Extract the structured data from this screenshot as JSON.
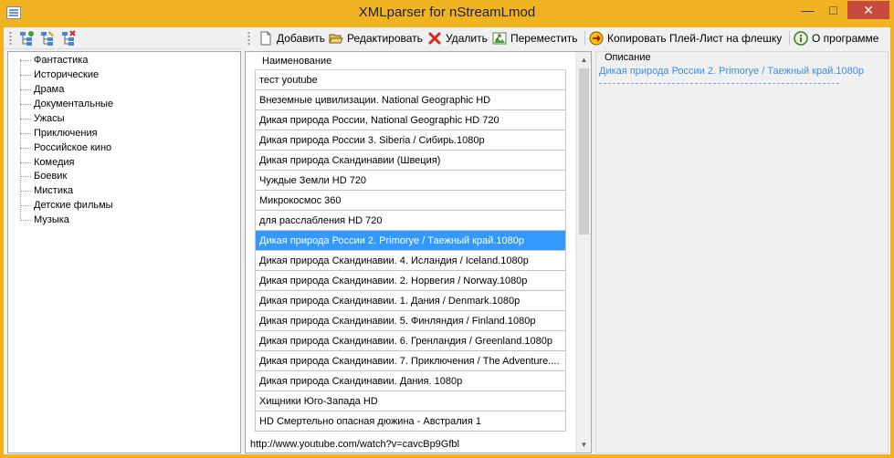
{
  "window": {
    "title": "XMLparser for nStreamLmod",
    "min_glyph": "—",
    "max_glyph": "□",
    "close_glyph": "✕"
  },
  "left_toolbar": {
    "icons": [
      "add-category-icon",
      "edit-category-icon",
      "delete-category-icon"
    ]
  },
  "tree": {
    "items": [
      "Фантастика",
      "Исторические",
      "Драма",
      "Документальные",
      "Ужасы",
      "Приключения",
      "Российское кино",
      "Комедия",
      "Боевик",
      "Мистика",
      "Детские фильмы",
      "Музыка"
    ]
  },
  "toolbar": {
    "add_label": "Добавить",
    "edit_label": "Редактировать",
    "delete_label": "Удалить",
    "move_label": "Переместить",
    "copy_label": "Копировать Плей-Лист на флешку",
    "about_label": "О программе"
  },
  "grid": {
    "column_header": "Наименование",
    "rows": [
      "тест youtube",
      "Внеземные цивилизации. National Geographic HD",
      "Дикая природа России, National Geographic HD 720",
      "Дикая природа России 3. Siberia / Сибирь.1080p",
      "Дикая природа Скандинавии (Швеция)",
      "Чуждые Земли HD 720",
      "Микрокосмос 360",
      "для расслабления HD 720",
      "Дикая природа России 2. Primorye / Таежный край.1080p",
      "Дикая природа Скандинавии. 4. Исландия / Iceland.1080p",
      "Дикая природа Скандинавии. 2. Норвегия / Norway.1080p",
      "Дикая природа Скандинавии. 1. Дания / Denmark.1080p",
      "Дикая природа Скандинавии. 5. Финляндия / Finland.1080p",
      "Дикая природа Скандинавии. 6. Гренландия / Greenland.1080p",
      "Дикая природа Скандинавии. 7. Приключения / The Adventure....",
      "Дикая природа Скандинавии. Дания. 1080p",
      "Хищники Юго-Запада HD",
      "HD Смертельно опасная дюжина - Австралия 1"
    ],
    "selected_index": 8
  },
  "description": {
    "legend": "Описание",
    "text": "Дикая природа России 2. Primorye / Таежный край.1080p"
  },
  "status": {
    "url": "http://www.youtube.com/watch?v=cavcBp9Gfbl"
  },
  "colors": {
    "title_bar": "#f0b322",
    "selection": "#3399ff",
    "description_text": "#3a8ee6",
    "close_button": "#c84a3c"
  }
}
